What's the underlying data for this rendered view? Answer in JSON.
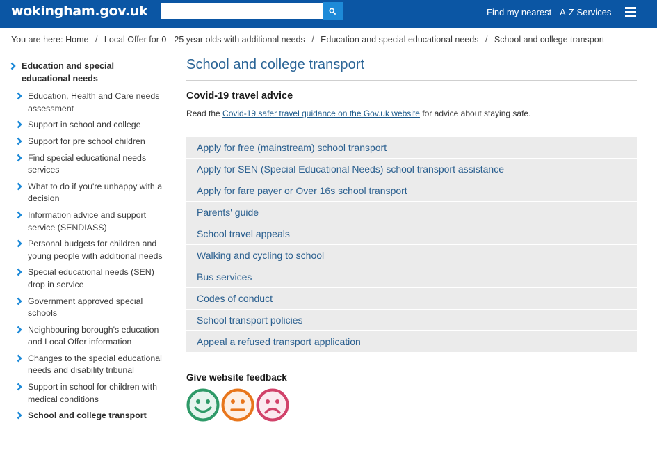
{
  "header": {
    "logo": "wokingham.gov.uk",
    "search": {
      "value": "",
      "placeholder": ""
    },
    "search_icon": "search-icon",
    "nav": {
      "find_nearest": "Find my nearest",
      "az_services": "A-Z Services"
    },
    "menu_icon": "hamburger-menu-icon"
  },
  "breadcrumb": {
    "prefix": "You are here:",
    "items": [
      "Home",
      "Local Offer for 0 - 25 year olds with additional needs",
      "Education and special educational needs",
      "School and college transport"
    ],
    "separator": "/"
  },
  "sidebar": {
    "parent": "Education and special educational needs",
    "items": [
      "Education, Health and Care needs assessment",
      "Support in school and college",
      "Support for pre school children",
      "Find special educational needs services",
      "What to do if you're unhappy with a decision",
      "Information advice and support service (SENDIASS)",
      "Personal budgets for children and young people with additional needs",
      "Special educational needs (SEN) drop in service",
      "Government approved special schools",
      "Neighbouring borough's education and Local Offer information",
      "Changes to the special educational needs and disability tribunal",
      "Support in school for children with medical conditions",
      "School and college transport"
    ],
    "current_index": 12
  },
  "main": {
    "title": "School and college transport",
    "covid": {
      "heading": "Covid-19 travel advice",
      "text_before": "Read the ",
      "link": "Covid-19 safer travel guidance on the Gov.uk website",
      "text_after": " for advice about staying safe."
    },
    "links": [
      "Apply for free (mainstream) school transport",
      "Apply for SEN (Special Educational Needs) school transport assistance",
      "Apply for fare payer or Over 16s school transport",
      "Parents' guide",
      "School travel appeals",
      "Walking and cycling to school",
      "Bus services",
      "Codes of conduct",
      "School transport policies",
      "Appeal a refused transport application"
    ],
    "feedback": {
      "title": "Give website feedback",
      "faces": [
        {
          "name": "happy",
          "color": "#2e9a68"
        },
        {
          "name": "neutral",
          "color": "#e8761c"
        },
        {
          "name": "sad",
          "color": "#d1426a"
        }
      ]
    }
  },
  "colors": {
    "header_bg": "#0b56a4",
    "search_button": "#1d8ad8",
    "link_blue": "#2a5f8f",
    "chevron": "#1d8ad8",
    "list_bg": "#ebebeb"
  }
}
